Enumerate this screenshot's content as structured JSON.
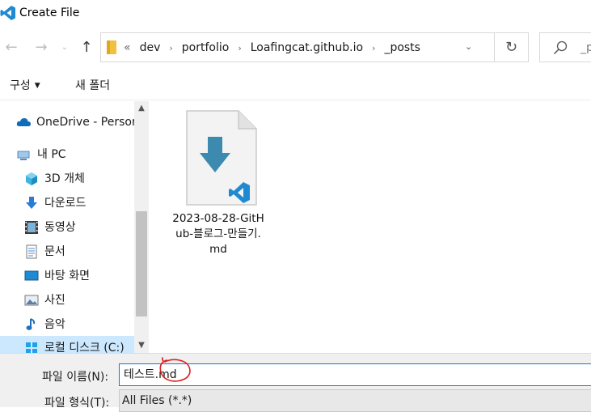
{
  "window": {
    "title": "Create File"
  },
  "nav": {
    "back": "←",
    "forward": "→",
    "up": "↑",
    "refresh": "↻"
  },
  "address": {
    "overflow": "«",
    "crumbs": [
      "dev",
      "portfolio",
      "Loafingcat.github.io",
      "_posts"
    ],
    "separator": "›"
  },
  "search": {
    "placeholder": "_p"
  },
  "toolbar": {
    "organize_label": "구성",
    "new_folder_label": "새 폴더"
  },
  "sidebar": {
    "items": [
      {
        "label": "OneDrive - Personal",
        "icon": "cloud-icon"
      },
      {
        "label": "내 PC",
        "icon": "computer-icon"
      },
      {
        "label": "3D 개체",
        "icon": "cube-3d-icon"
      },
      {
        "label": "다운로드",
        "icon": "download-arrow-icon"
      },
      {
        "label": "동영상",
        "icon": "film-icon"
      },
      {
        "label": "문서",
        "icon": "document-icon"
      },
      {
        "label": "바탕 화면",
        "icon": "desktop-icon"
      },
      {
        "label": "사진",
        "icon": "picture-icon"
      },
      {
        "label": "음악",
        "icon": "music-note-icon"
      },
      {
        "label": "로컬 디스크 (C:)",
        "icon": "windows-drive-icon"
      }
    ]
  },
  "files": [
    {
      "name": "2023-08-28-GitHub-블로그-만들기.md",
      "icon": "markdown-vscode-file-icon"
    }
  ],
  "bottom": {
    "filename_label": "파일 이름(N):",
    "filename_value": "테스트.md",
    "filetype_label": "파일 형식(T):",
    "filetype_value": "All Files (*.*)"
  },
  "colors": {
    "accent": "#1e73d8",
    "vscode_blue": "#1f8ad2",
    "annotation_red": "#e02020"
  }
}
